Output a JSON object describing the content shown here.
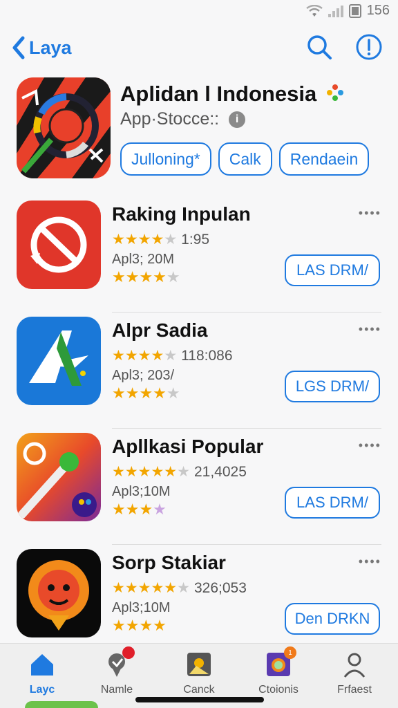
{
  "status": {
    "time": "156"
  },
  "nav": {
    "back_label": "Laya"
  },
  "hero": {
    "title": "Aplidan l Indonesia",
    "subtitle": "App·Stocce::",
    "info_glyph": "i",
    "chips": [
      "Julloning*",
      "Calk",
      "Rendaein"
    ]
  },
  "apps": [
    {
      "title": "Raking Inpulan",
      "rating_text": "1:95",
      "meta": "Apl3; 20M",
      "download_label": "LAS DRM/",
      "more": "••••"
    },
    {
      "title": "Alpr Sadia",
      "rating_text": "118:086",
      "meta": "Apl3; 203/",
      "download_label": "LGS DRM/",
      "more": "••••"
    },
    {
      "title": "Apllkasi Popular",
      "rating_text": "21,4025",
      "meta": "Apl3;10M",
      "download_label": "LAS DRM/",
      "more": "••••"
    },
    {
      "title": "Sorp Stakiar",
      "rating_text": "326;053",
      "meta": "Apl3;10M",
      "download_label": "Den DRKN",
      "more": "••••"
    }
  ],
  "tabs": [
    {
      "label": "Layc",
      "icon": "home-icon",
      "active": true
    },
    {
      "label": "Namle",
      "icon": "pin-icon",
      "badge": ""
    },
    {
      "label": "Canck",
      "icon": "image-icon"
    },
    {
      "label": "Ctoionis",
      "icon": "window-icon",
      "badge": "1"
    },
    {
      "label": "Frfaest",
      "icon": "person-icon"
    }
  ],
  "colors": {
    "accent": "#1f7ae0",
    "star": "#f2a500"
  }
}
